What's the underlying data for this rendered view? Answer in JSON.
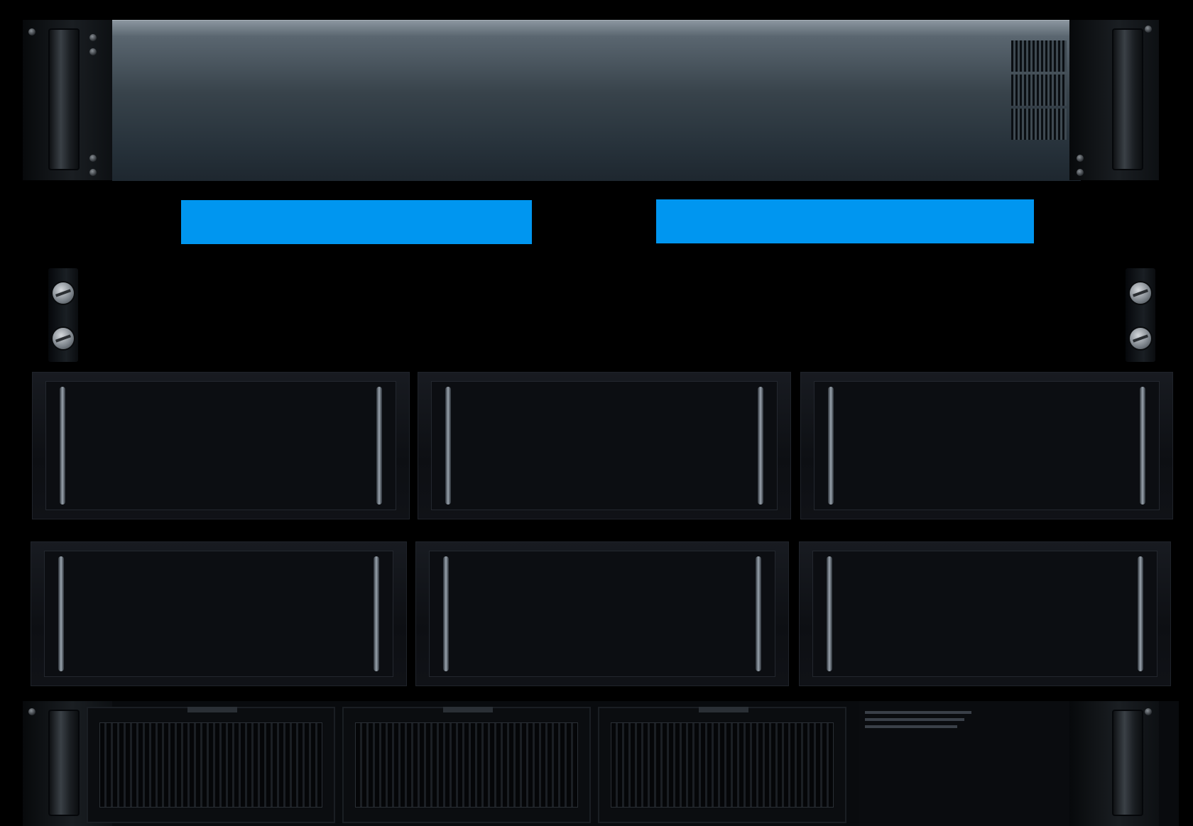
{
  "colors": {
    "accent_blue": "#0096f0",
    "background": "#000000",
    "faceplate_top": "#8b969f",
    "faceplate_bottom": "#1e272f"
  },
  "buttons": [
    {
      "label": ""
    },
    {
      "label": ""
    }
  ],
  "drive_bays": [
    {
      "row": 1,
      "slot": 1
    },
    {
      "row": 1,
      "slot": 2
    },
    {
      "row": 1,
      "slot": 3
    },
    {
      "row": 2,
      "slot": 1
    },
    {
      "row": 2,
      "slot": 2
    },
    {
      "row": 2,
      "slot": 3
    }
  ],
  "fans": [
    1,
    2,
    3
  ]
}
